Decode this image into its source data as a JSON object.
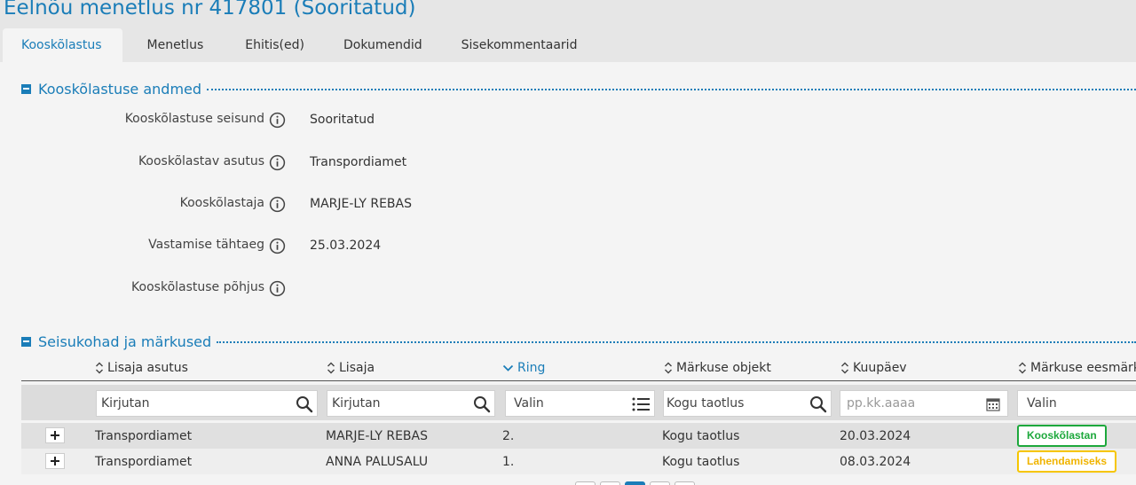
{
  "page": {
    "title": "Eelnõu menetlus nr 417801 (Sooritatud)"
  },
  "tabs": [
    {
      "label": "Kooskõlastus",
      "active": true
    },
    {
      "label": "Menetlus",
      "active": false
    },
    {
      "label": "Ehitis(ed)",
      "active": false
    },
    {
      "label": "Dokumendid",
      "active": false
    },
    {
      "label": "Sisekommentaarid",
      "active": false
    }
  ],
  "section1": {
    "title": "Kooskõlastuse andmed",
    "fields": [
      {
        "label": "Kooskõlastuse seisund",
        "value": "Sooritatud"
      },
      {
        "label": "Kooskõlastav asutus",
        "value": "Transpordiamet"
      },
      {
        "label": "Kooskõlastaja",
        "value": "MARJE-LY REBAS"
      },
      {
        "label": "Vastamise tähtaeg",
        "value": "25.03.2024"
      },
      {
        "label": "Kooskõlastuse põhjus",
        "value": ""
      }
    ]
  },
  "section2": {
    "title": "Seisukohad ja märkused",
    "columns": [
      {
        "label": "Lisaja asutus",
        "sort": "none"
      },
      {
        "label": "Lisaja",
        "sort": "none"
      },
      {
        "label": "Ring",
        "sort": "desc"
      },
      {
        "label": "Märkuse objekt",
        "sort": "none"
      },
      {
        "label": "Kuupäev",
        "sort": "none"
      },
      {
        "label": "Märkuse eesmärk",
        "sort": "none"
      }
    ],
    "filters": [
      {
        "value": "Kirjutan",
        "placeholder": false,
        "icon": "search-icon"
      },
      {
        "value": "Kirjutan",
        "placeholder": false,
        "icon": "search-icon"
      },
      {
        "value": "Valin",
        "placeholder": false,
        "icon": "list-icon"
      },
      {
        "value": "Kogu taotlus",
        "placeholder": false,
        "icon": "search-icon"
      },
      {
        "value": "pp.kk.aaaa",
        "placeholder": true,
        "icon": "calendar-icon"
      },
      {
        "value": "Valin",
        "placeholder": false,
        "icon": ""
      }
    ],
    "rows": [
      {
        "asutus": "Transpordiamet",
        "lisaja": "MARJE-LY REBAS",
        "ring": "2.",
        "objekt": "Kogu taotlus",
        "kuupaev": "20.03.2024",
        "eesmark": "Kooskõlastan",
        "eesmark_color": "#1da83c"
      },
      {
        "asutus": "Transpordiamet",
        "lisaja": "ANNA PALUSALU",
        "ring": "1.",
        "objekt": "Kogu taotlus",
        "kuupaev": "08.03.2024",
        "eesmark": "Lahendamiseks",
        "eesmark_color": "#f0b400"
      }
    ]
  },
  "colors": {
    "accent": "#1a7db8",
    "approve": "#1da83c",
    "resolve": "#f0b400"
  }
}
